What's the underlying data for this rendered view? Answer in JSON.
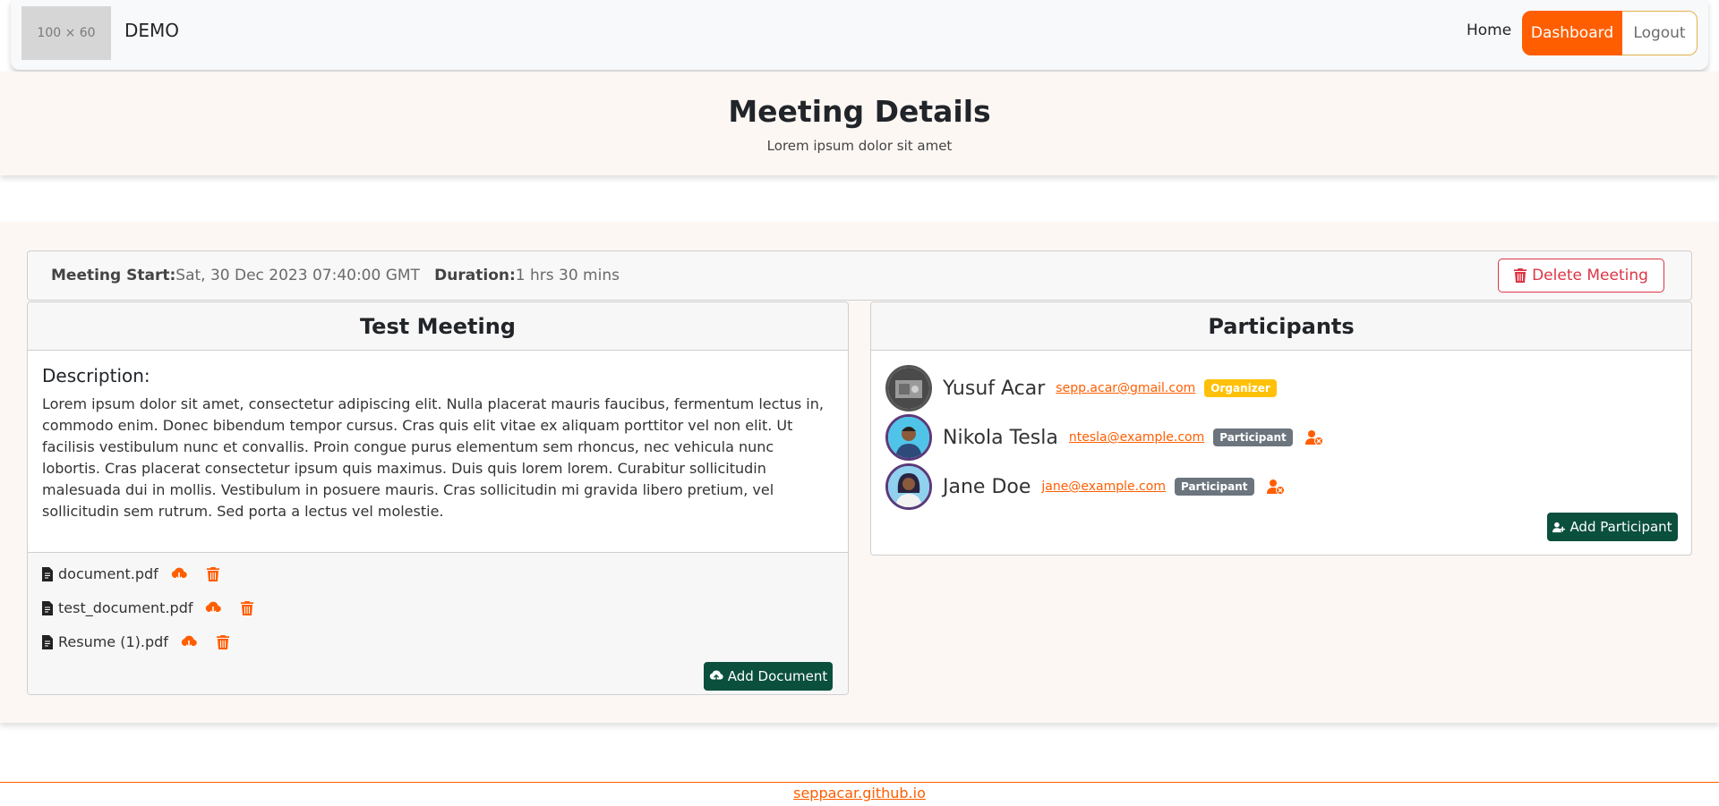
{
  "navbar": {
    "logo_placeholder": "100 × 60",
    "brand": "DEMO",
    "links": {
      "home": "Home",
      "dashboard": "Dashboard",
      "logout": "Logout"
    }
  },
  "header": {
    "title": "Meeting Details",
    "subtitle": "Lorem ipsum dolor sit amet"
  },
  "meeting": {
    "start_label": "Meeting Start:",
    "start_value": "Sat, 30 Dec 2023 07:40:00 GMT",
    "duration_label": "Duration:",
    "duration_value": "1 hrs 30 mins",
    "delete_label": "Delete Meeting",
    "title": "Test Meeting",
    "description_heading": "Description:",
    "description": "Lorem ipsum dolor sit amet, consectetur adipiscing elit. Nulla placerat mauris faucibus, fermentum lectus in, commodo enim. Donec bibendum tempor cursus. Cras quis elit vitae ex aliquam porttitor vel non elit. Ut facilisis vestibulum nunc et convallis. Proin congue purus elementum sem rhoncus, nec vehicula nunc lobortis. Cras placerat consectetur ipsum quis maximus. Duis quis lorem lorem. Curabitur sollicitudin malesuada dui in mollis. Vestibulum in posuere mauris. Cras sollicitudin mi gravida libero pretium, vel sollicitudin sem rutrum. Sed porta a lectus vel molestie.",
    "documents": [
      {
        "name": "document.pdf"
      },
      {
        "name": "test_document.pdf"
      },
      {
        "name": "Resume (1).pdf"
      }
    ],
    "add_document_label": "Add Document"
  },
  "participants": {
    "heading": "Participants",
    "list": [
      {
        "name": "Yusuf Acar",
        "email": "sepp.acar@gmail.com",
        "role": "Organizer"
      },
      {
        "name": "Nikola Tesla",
        "email": "ntesla@example.com",
        "role": "Participant"
      },
      {
        "name": "Jane Doe",
        "email": "jane@example.com",
        "role": "Participant"
      }
    ],
    "add_label": "Add Participant"
  },
  "footer": {
    "link": "seppacar.github.io"
  },
  "colors": {
    "accent": "#ff5e00",
    "dark_green": "#0b4f3d",
    "danger": "#dc3545",
    "organizer_badge": "#ffc107",
    "participant_badge": "#6c757d"
  },
  "icons": [
    "file-icon",
    "cloud-download-icon",
    "trash-icon",
    "user-remove-icon",
    "cloud-upload-icon",
    "user-add-icon"
  ]
}
